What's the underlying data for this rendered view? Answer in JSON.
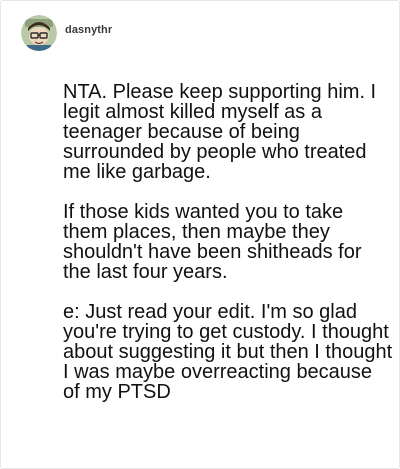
{
  "post": {
    "username": "dasnythr",
    "avatar_icon": "cartoon-avatar-icon",
    "paragraphs": [
      "NTA. Please keep supporting him. I legit almost killed myself as a teenager because of being surrounded by people who treated me like garbage.",
      "If those kids wanted you to take them places, then maybe they shouldn't have been shitheads for the last four years.",
      "e: Just read your edit. I'm so glad you're trying to get custody. I thought about suggesting it but then I thought I was maybe overreacting because of my PTSD"
    ]
  },
  "colors": {
    "username": "#3a3a3a",
    "text": "#111111",
    "border": "#e6e6e6"
  }
}
